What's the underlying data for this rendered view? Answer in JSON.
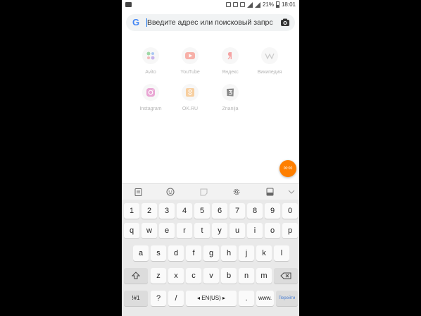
{
  "status_bar": {
    "battery": "21%",
    "time": "18:01"
  },
  "browser": {
    "search_placeholder": "Введите адрес или поисковый запрос",
    "logo_letter": "G"
  },
  "shortcuts": [
    {
      "label": "Avito",
      "icon": "avito-icon"
    },
    {
      "label": "YouTube",
      "icon": "youtube-icon"
    },
    {
      "label": "Яндекс",
      "icon": "yandex-icon"
    },
    {
      "label": "Википедия",
      "icon": "wikipedia-icon"
    },
    {
      "label": "Instagram",
      "icon": "instagram-icon"
    },
    {
      "label": "OK.RU",
      "icon": "ok-icon"
    },
    {
      "label": "Znanija",
      "icon": "znanija-icon"
    }
  ],
  "fab_label": "00:00",
  "keyboard": {
    "row_numbers": [
      "1",
      "2",
      "3",
      "4",
      "5",
      "6",
      "7",
      "8",
      "9",
      "0"
    ],
    "row1": [
      "q",
      "w",
      "e",
      "r",
      "t",
      "y",
      "u",
      "i",
      "o",
      "p"
    ],
    "row2": [
      "a",
      "s",
      "d",
      "f",
      "g",
      "h",
      "j",
      "k",
      "l"
    ],
    "row3": [
      "z",
      "x",
      "c",
      "v",
      "b",
      "n",
      "m"
    ],
    "sym_key": "!#1",
    "question_key": "?",
    "slash_key": "/",
    "space_key": "◂ EN(US) ▸",
    "dot_key": ".",
    "www_key": "www.",
    "go_key": "Перейти"
  },
  "colors": {
    "accent": "#ff7f00",
    "google_blue": "#4285f4",
    "keyboard_bg": "#e9e9e9"
  }
}
